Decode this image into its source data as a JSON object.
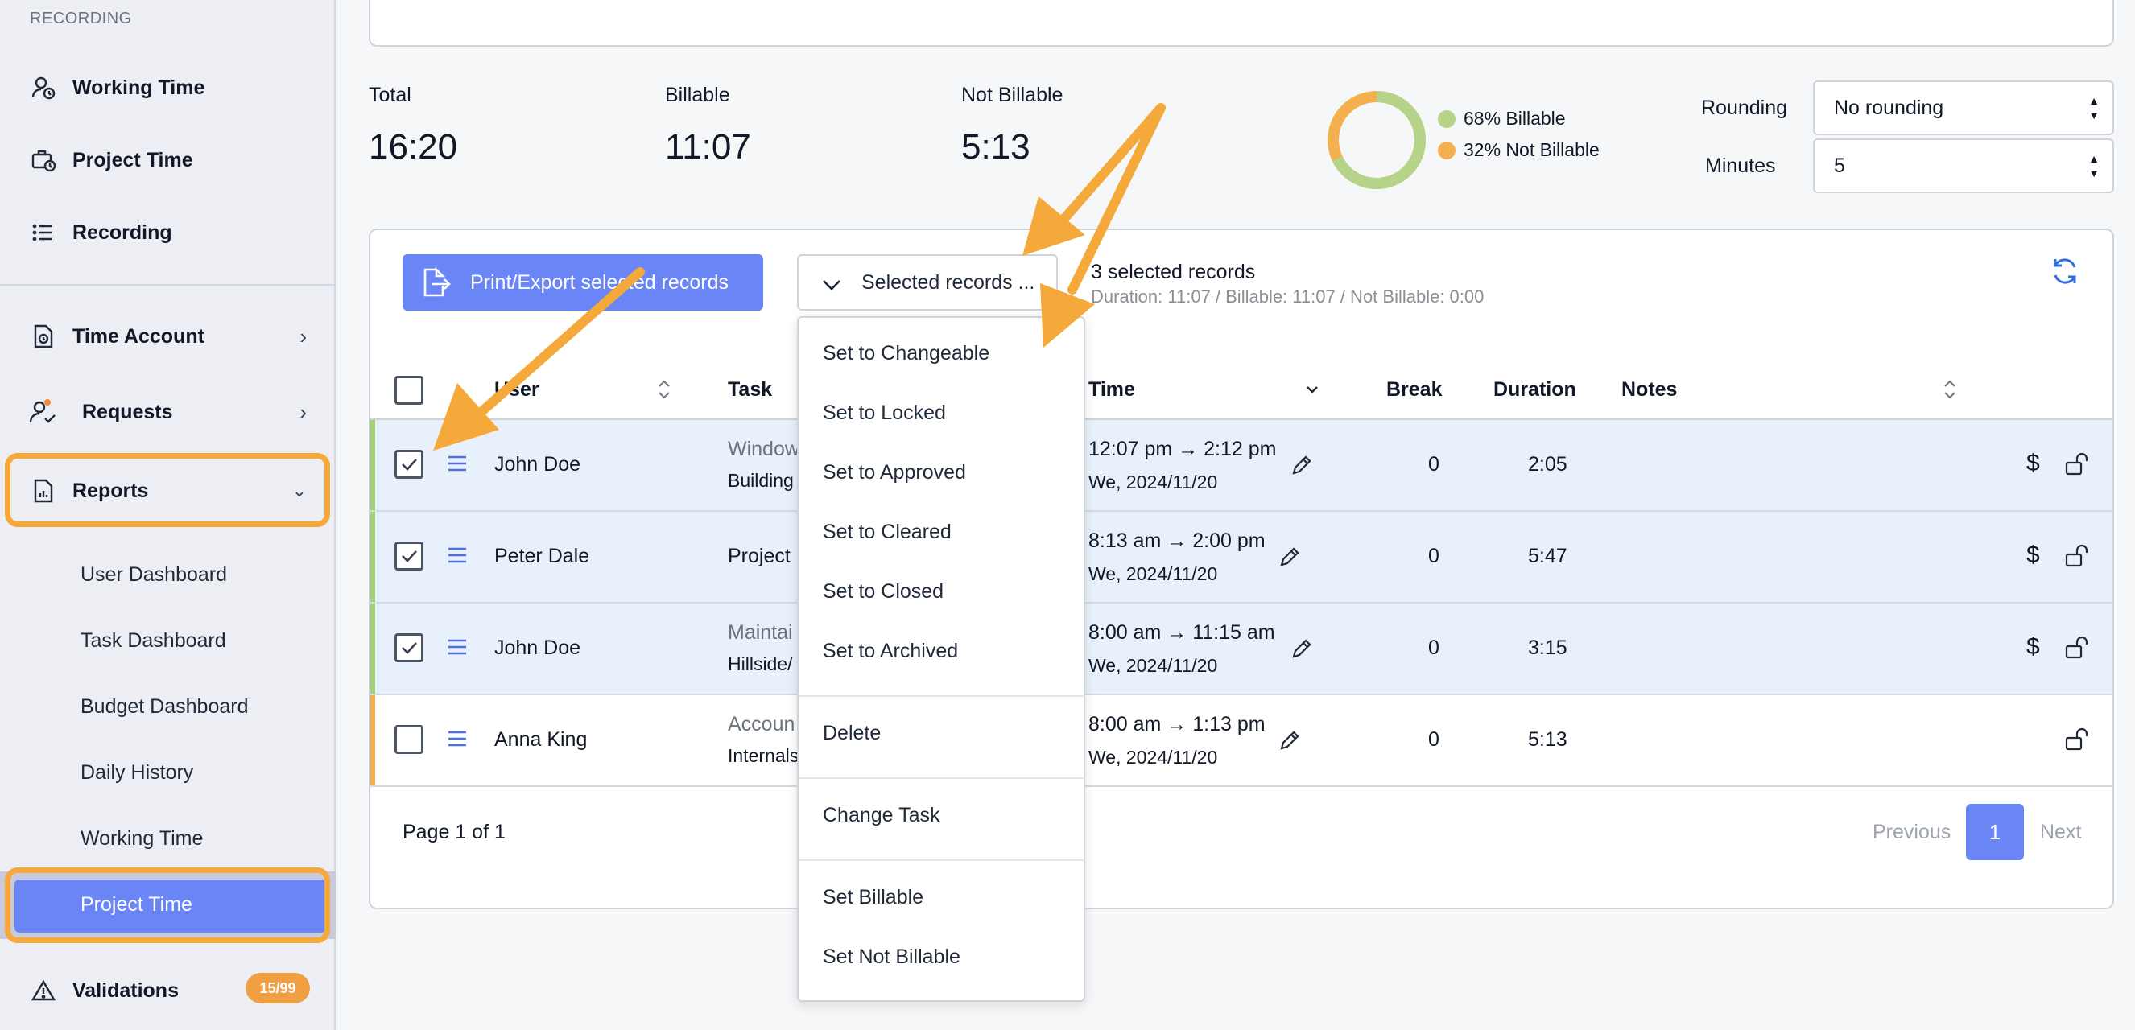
{
  "sidebar": {
    "section_label": "RECORDING",
    "items": {
      "working_time": "Working Time",
      "project_time": "Project Time",
      "recording": "Recording",
      "time_account": "Time Account",
      "requests": "Requests",
      "reports": "Reports",
      "validations": "Validations"
    },
    "reports_sub": [
      "User Dashboard",
      "Task Dashboard",
      "Budget Dashboard",
      "Daily History",
      "Working Time",
      "Project Time"
    ],
    "validations_badge": "15/99"
  },
  "summary": {
    "total_label": "Total",
    "total_value": "16:20",
    "billable_label": "Billable",
    "billable_value": "11:07",
    "not_billable_label": "Not Billable",
    "not_billable_value": "5:13",
    "legend_billable": "68% Billable",
    "legend_not_billable": "32% Not Billable",
    "billable_fraction": 0.68,
    "rounding_label": "Rounding",
    "rounding_value": "No rounding",
    "minutes_label": "Minutes",
    "minutes_value": "5"
  },
  "toolbar": {
    "export_label": "Print/Export selected records",
    "selected_label": "Selected records ...",
    "selected_count": "3 selected records",
    "selected_summary": "Duration: 11:07 / Billable: 11:07 / Not Billable: 0:00"
  },
  "table": {
    "headers": {
      "user": "User",
      "task": "Task",
      "time": "Time",
      "break": "Break",
      "duration": "Duration",
      "notes": "Notes"
    },
    "rows": [
      {
        "user": "John Doe",
        "task1": "Window",
        "task2": "Building",
        "time": "12:07 pm → 2:12 pm",
        "date": "We, 2024/11/20",
        "break": "0",
        "duration": "2:05"
      },
      {
        "user": "Peter Dale",
        "task1": "Project",
        "task2": "",
        "time": "8:13 am → 2:00 pm",
        "date": "We, 2024/11/20",
        "break": "0",
        "duration": "5:47"
      },
      {
        "user": "John Doe",
        "task1": "Maintai",
        "task2": "Hillside/",
        "time": "8:00 am → 11:15 am",
        "date": "We, 2024/11/20",
        "break": "0",
        "duration": "3:15"
      },
      {
        "user": "Anna King",
        "task1": "Accoun",
        "task2": "Internals",
        "time": "8:00 am → 1:13 pm",
        "date": "We, 2024/11/20",
        "break": "0",
        "duration": "5:13"
      }
    ]
  },
  "pagination": {
    "page_label": "Page 1 of 1",
    "previous": "Previous",
    "current": "1",
    "next": "Next"
  },
  "dropdown": {
    "items": [
      "Set to Changeable",
      "Set to Locked",
      "Set to Approved",
      "Set to Cleared",
      "Set to Closed",
      "Set to Archived",
      "Delete",
      "Change Task",
      "Set Billable",
      "Set Not Billable"
    ]
  },
  "colors": {
    "accent": "#6a85f5",
    "billable": "#b5d48a",
    "not_billable": "#f4b04e",
    "highlight": "#f4a93a"
  }
}
